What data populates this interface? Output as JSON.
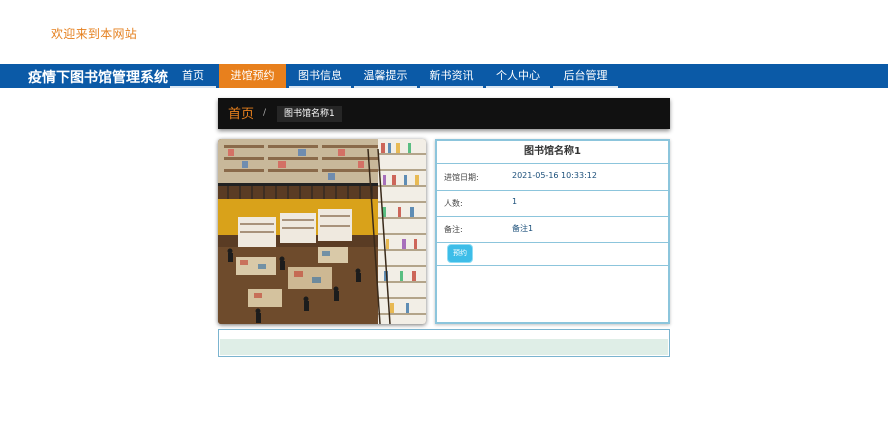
{
  "header": {
    "welcome_text": "欢迎来到本网站"
  },
  "navbar": {
    "site_title": "疫情下图书馆管理系统",
    "items": [
      {
        "label": "首页"
      },
      {
        "label": "进馆预约"
      },
      {
        "label": "图书信息"
      },
      {
        "label": "温馨提示"
      },
      {
        "label": "新书资讯"
      },
      {
        "label": "个人中心"
      },
      {
        "label": "后台管理"
      }
    ],
    "active_index": 1,
    "bar_color": "#0b5aa7",
    "active_color": "#e8801d"
  },
  "breadcrumb": {
    "home": "首页",
    "separator": "/",
    "current": "图书馆名称1"
  },
  "detail": {
    "title": "图书馆名称1",
    "rows": [
      {
        "label": "进馆日期:",
        "value": "2021-05-16 10:33:12"
      },
      {
        "label": "人数:",
        "value": "1"
      },
      {
        "label": "备注:",
        "value": "备注1"
      }
    ],
    "reserve_button": "预约"
  }
}
